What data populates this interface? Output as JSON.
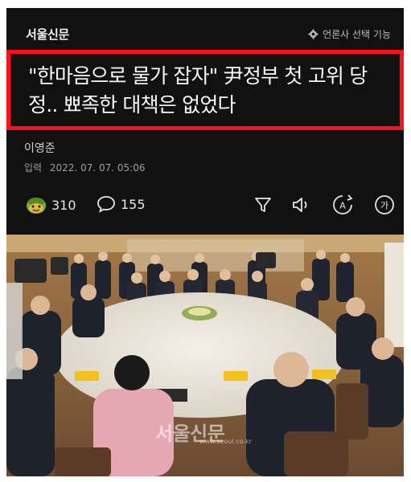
{
  "header": {
    "brand": "서울신문",
    "press_select_label": "언론사 선택 기능"
  },
  "article": {
    "headline": "\"한마음으로 물가 잡자\" 尹정부 첫 고위 당정.. 뾰족한 대책은 없었다",
    "author": "이영준",
    "date_label": "입력",
    "date_value": "2022. 07. 07. 05:06",
    "reaction_count": "310",
    "comment_count": "155"
  },
  "toolbar": {
    "icons": [
      "filter-icon",
      "speaker-icon",
      "translate-icon",
      "font-size-icon"
    ],
    "font_size_glyph": "가",
    "translate_glyph": "A"
  },
  "photo": {
    "watermark": "서울신문",
    "watermark_url": "www.seoul.co.kr"
  },
  "colors": {
    "highlight_border": "#ff0f17",
    "background": "#111111"
  }
}
